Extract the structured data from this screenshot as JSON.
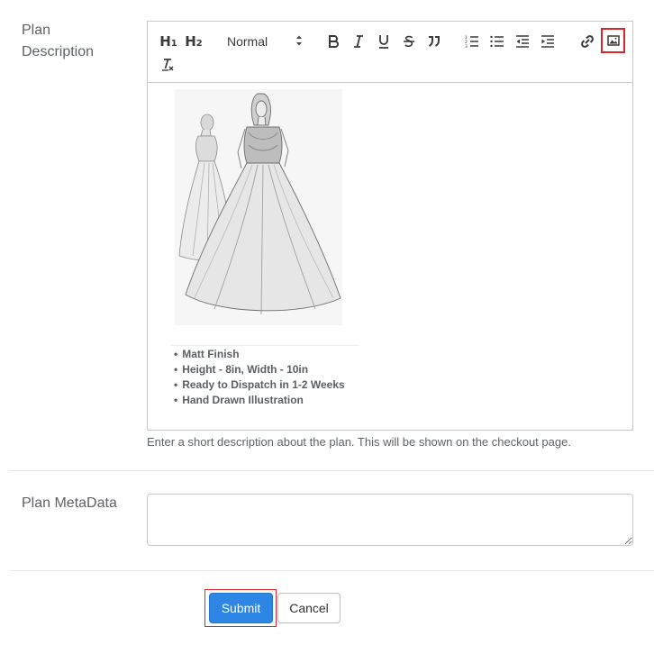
{
  "labels": {
    "plan_description": "Plan Description",
    "plan_metadata": "Plan MetaData"
  },
  "editor": {
    "toolbar": {
      "h1": "H",
      "h1_sub": "1",
      "h2": "H",
      "h2_sub": "2",
      "format_select": "Normal",
      "icons": [
        "bold-icon",
        "italic-icon",
        "underline-icon",
        "strikethrough-icon",
        "blockquote-icon",
        "ordered-list-icon",
        "bullet-list-icon",
        "outdent-icon",
        "indent-icon",
        "link-icon",
        "image-icon",
        "clear-format-icon"
      ]
    },
    "content": {
      "bullets": [
        "Matt Finish",
        "Height - 8in, Width - 10in",
        "Ready to Dispatch in 1-2 Weeks",
        "Hand Drawn Illustration"
      ]
    }
  },
  "helper_text": "Enter a short description about the plan. This will be shown on the checkout page.",
  "metadata_value": "",
  "buttons": {
    "submit": "Submit",
    "cancel": "Cancel"
  },
  "colors": {
    "primary": "#2d86e3",
    "highlight": "#d9262c"
  }
}
